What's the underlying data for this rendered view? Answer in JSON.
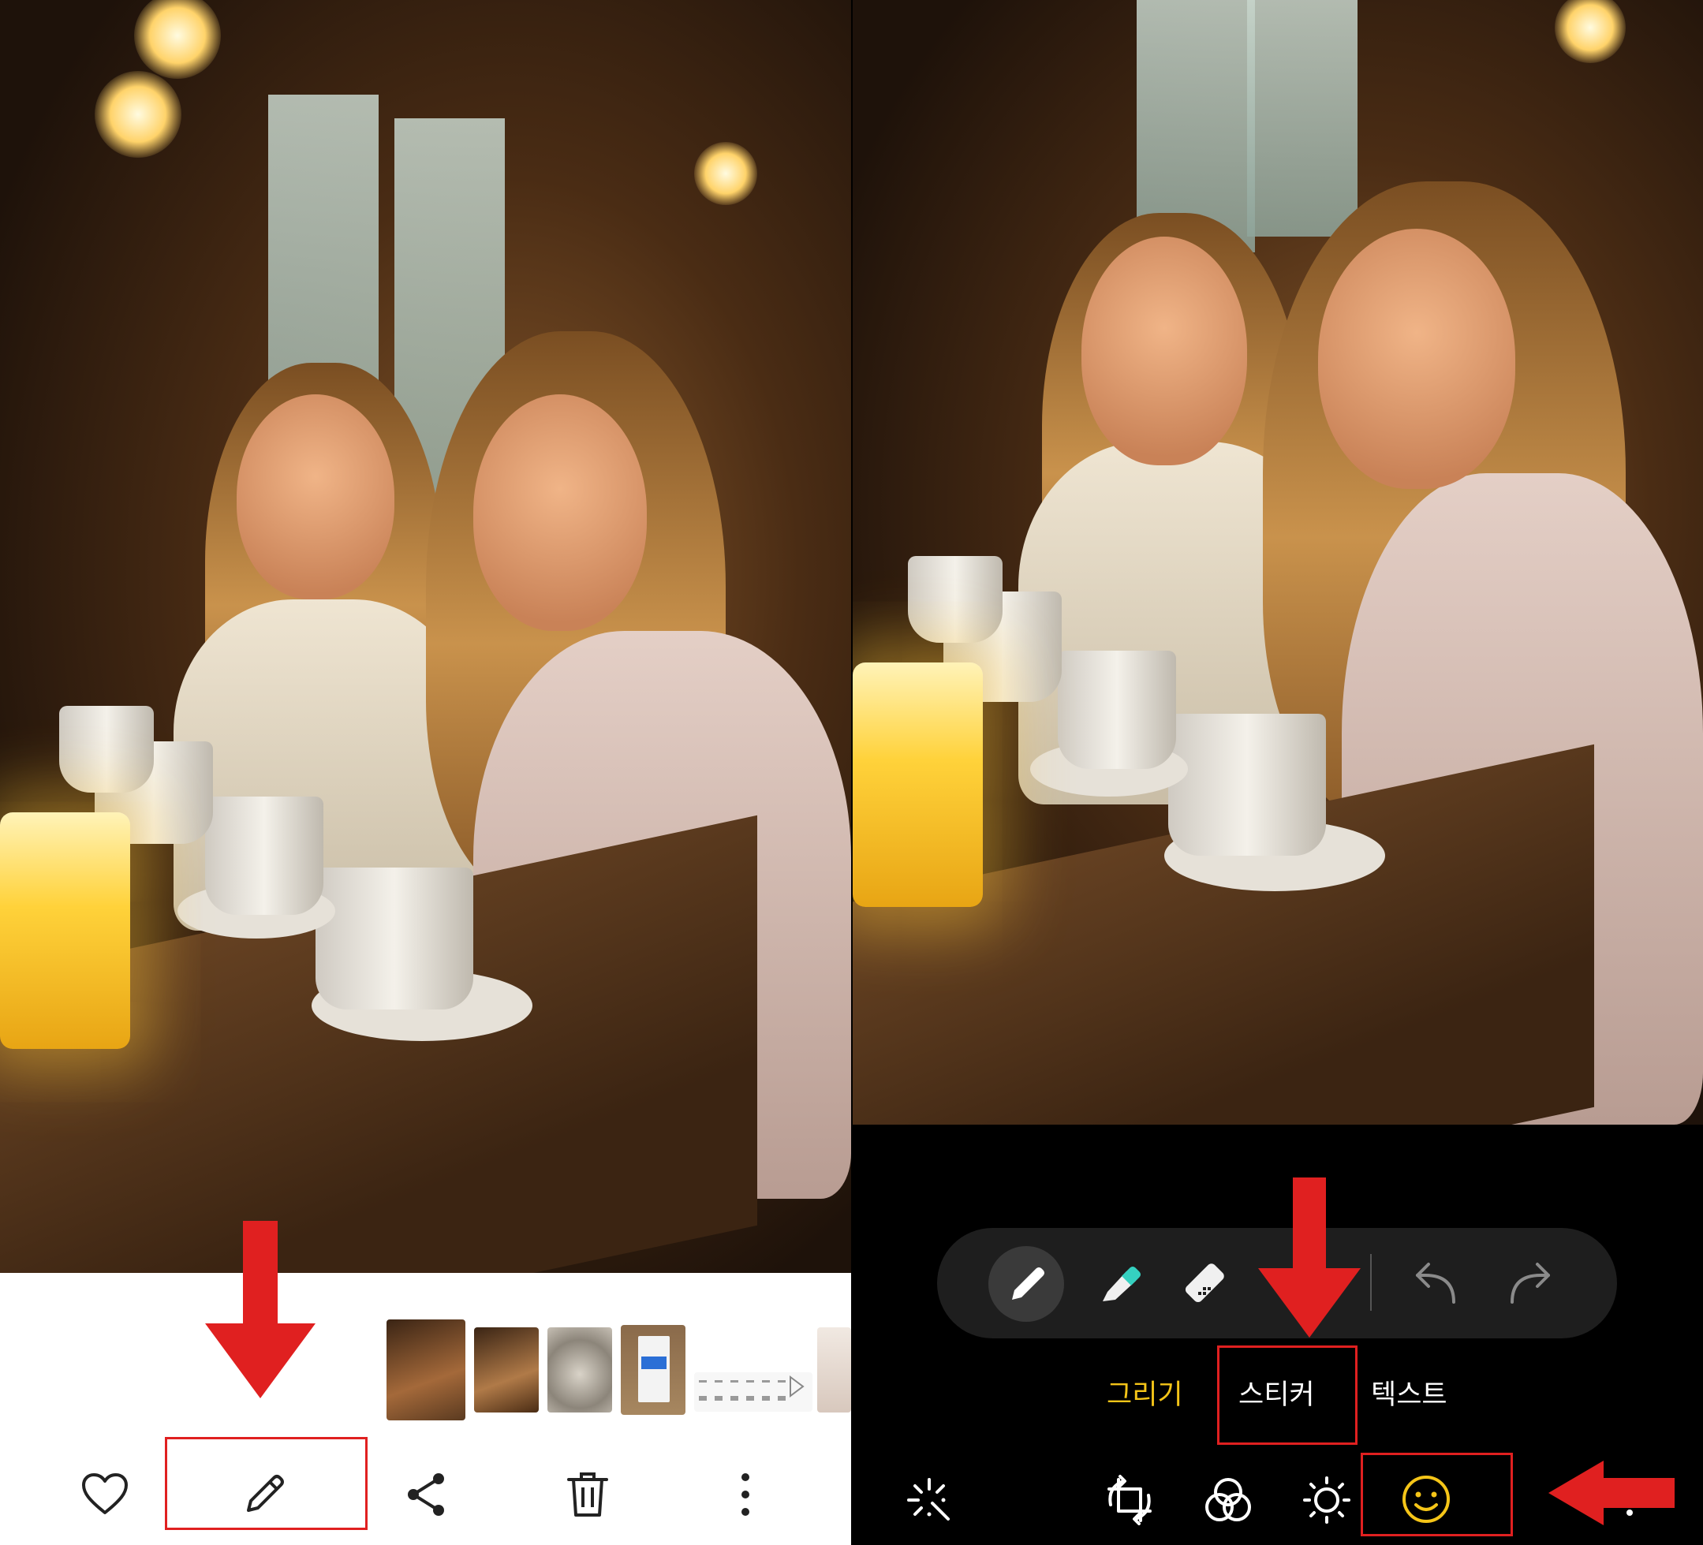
{
  "left_panel": {
    "photo_description_icon": "photo-view",
    "thumbnails": [
      {
        "name": "thumb-cafe-1"
      },
      {
        "name": "thumb-cafe-2"
      },
      {
        "name": "thumb-kittens"
      },
      {
        "name": "thumb-receipt"
      },
      {
        "name": "thumb-screenshot"
      },
      {
        "name": "thumb-partial"
      }
    ],
    "actions": [
      {
        "name": "favorite-button",
        "icon": "heart-icon"
      },
      {
        "name": "edit-button",
        "icon": "pencil-icon"
      },
      {
        "name": "share-button",
        "icon": "share-icon"
      },
      {
        "name": "delete-button",
        "icon": "trash-icon"
      },
      {
        "name": "more-button",
        "icon": "more-vertical-icon"
      }
    ]
  },
  "right_panel": {
    "draw_tools": [
      {
        "name": "pen-tool",
        "icon": "pen-icon"
      },
      {
        "name": "highlighter-tool",
        "icon": "highlighter-icon"
      },
      {
        "name": "eraser-tool",
        "icon": "eraser-icon"
      },
      {
        "name": "undo-button",
        "icon": "undo-icon"
      },
      {
        "name": "redo-button",
        "icon": "redo-icon"
      }
    ],
    "tabs": {
      "draw": "그리기",
      "sticker": "스티커",
      "text": "텍스트"
    },
    "bottom_tools": [
      {
        "name": "auto-enhance-button",
        "icon": "sparkle-icon"
      },
      {
        "name": "crop-rotate-button",
        "icon": "crop-icon"
      },
      {
        "name": "filters-button",
        "icon": "filters-icon"
      },
      {
        "name": "brightness-button",
        "icon": "brightness-icon"
      },
      {
        "name": "decorate-button",
        "icon": "smiley-icon"
      }
    ]
  },
  "colors": {
    "accent_yellow": "#f5c518",
    "highlight_red": "#e02020",
    "toolbar_bg": "#1e1e1e",
    "highlighter_teal": "#35d1c0"
  }
}
